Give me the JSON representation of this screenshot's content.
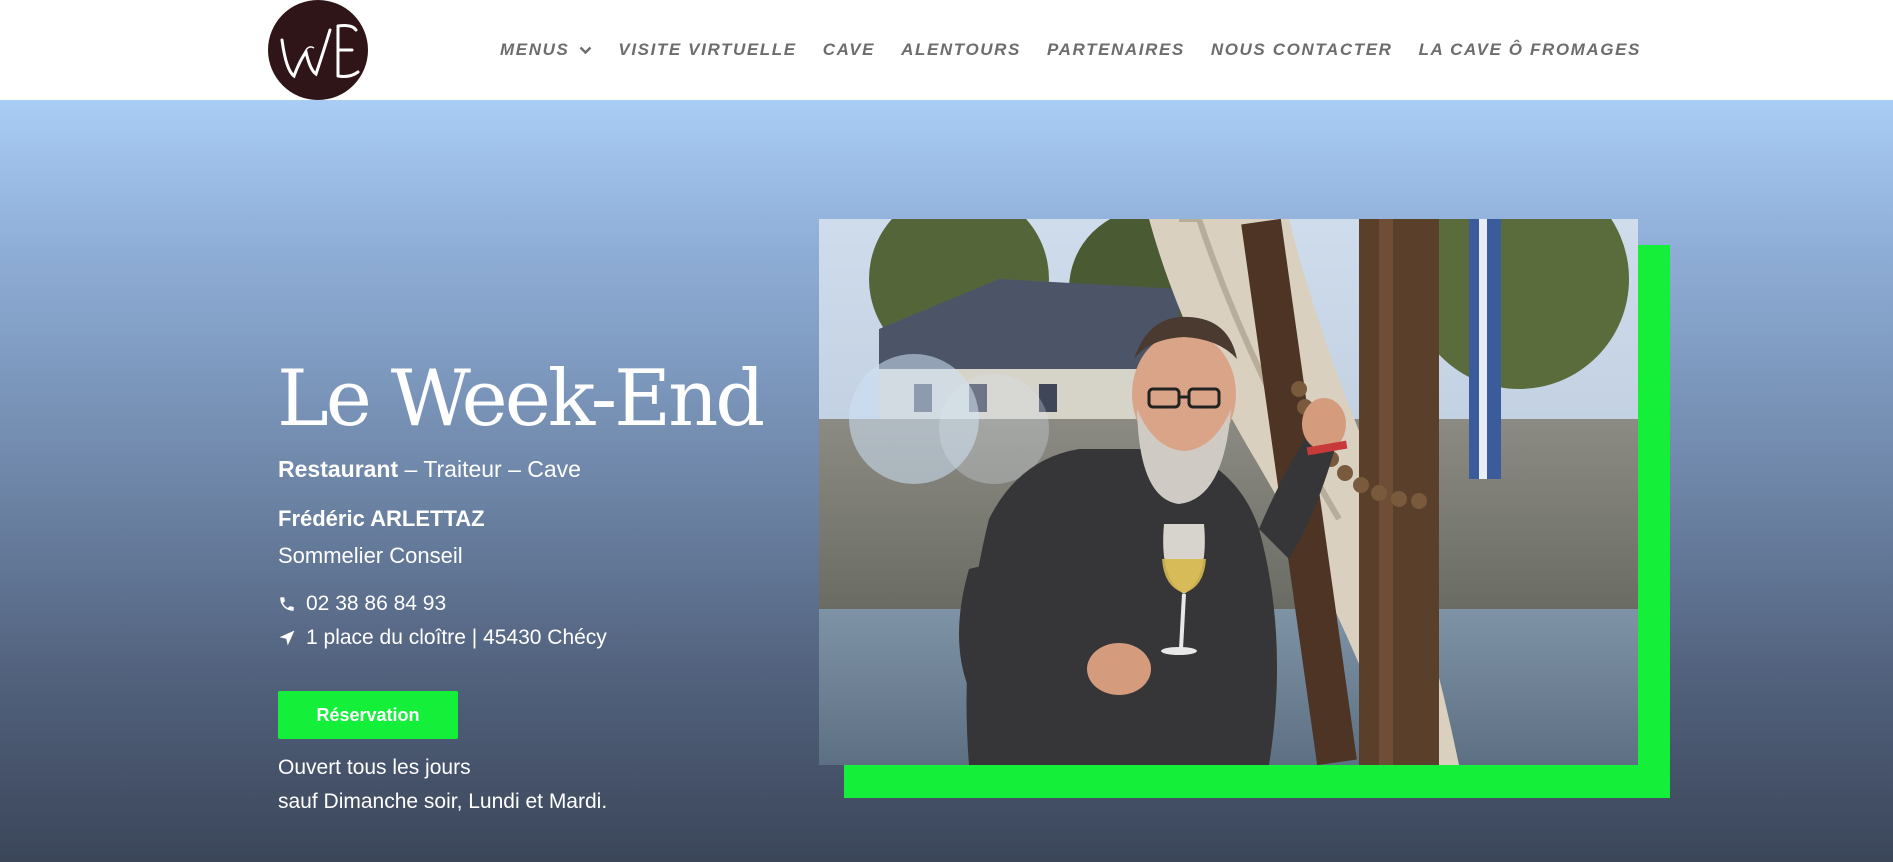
{
  "header": {
    "logo_text": "WE",
    "nav": [
      {
        "label": "MENUS",
        "has_dropdown": true
      },
      {
        "label": "VISITE VIRTUELLE"
      },
      {
        "label": "CAVE"
      },
      {
        "label": "ALENTOURS"
      },
      {
        "label": "PARTENAIRES"
      },
      {
        "label": "NOUS CONTACTER"
      },
      {
        "label": "LA CAVE Ô FROMAGES"
      }
    ]
  },
  "hero": {
    "title": "Le Week-End",
    "tagline": {
      "bold": "Restaurant",
      "rest": " – Traiteur – Cave"
    },
    "owner_name": "Frédéric ARLETTAZ",
    "owner_role": "Sommelier Conseil",
    "phone": "02 38 86 84 93",
    "address": "1 place du cloître | 45430 Chécy",
    "reservation_label": "Réservation",
    "hours_line1": "Ouvert tous les jours",
    "hours_line2": "sauf Dimanche soir, Lundi et Mardi."
  },
  "colors": {
    "accent_green": "#14ef3a",
    "nav_text": "#6d6d6d",
    "logo_bg": "#2f1517"
  },
  "icons": {
    "phone": "phone-icon",
    "location": "location-arrow-icon",
    "dropdown": "chevron-down-icon"
  }
}
